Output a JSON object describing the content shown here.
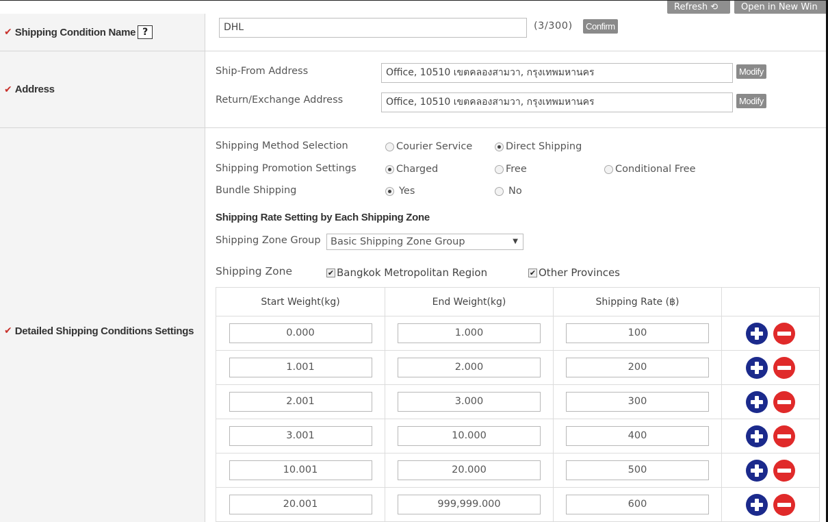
{
  "topbar": {
    "refresh_label": "Refresh ⟲",
    "open_new_label": "Open in New Win"
  },
  "shipping_condition_name": {
    "label": "Shipping Condition Name",
    "help": "?",
    "value": "DHL",
    "counter": "(3/300)",
    "confirm_label": "Confirm"
  },
  "address": {
    "label": "Address",
    "ship_from_label": "Ship-From Address",
    "ship_from_value": "Office, 10510 เขตคลองสามวา, กรุงเทพมหานคร",
    "return_label": "Return/Exchange Address",
    "return_value": "Office, 10510 เขตคลองสามวา, กรุงเทพมหานคร",
    "modify_label": "Modify"
  },
  "detailed": {
    "label": "Detailed Shipping Conditions Settings",
    "method": {
      "label": "Shipping Method Selection",
      "options": [
        "Courier Service",
        "Direct Shipping"
      ],
      "selected": 1
    },
    "promotion": {
      "label": "Shipping Promotion Settings",
      "options": [
        "Charged",
        "Free",
        "Conditional Free"
      ],
      "selected": 0
    },
    "bundle": {
      "label": "Bundle Shipping",
      "options": [
        "Yes",
        "No"
      ],
      "selected": 0
    },
    "rate_section_title": "Shipping Rate Setting by Each Shipping Zone",
    "zone_group": {
      "label": "Shipping Zone Group",
      "value": "Basic Shipping Zone Group"
    },
    "zone": {
      "label": "Shipping Zone",
      "options": [
        "Bangkok Metropolitan Region",
        "Other Provinces"
      ]
    },
    "table": {
      "headers": [
        "Start Weight(kg)",
        "End Weight(kg)",
        "Shipping Rate (฿)"
      ],
      "rows": [
        [
          "0.000",
          "1.000",
          "100"
        ],
        [
          "1.001",
          "2.000",
          "200"
        ],
        [
          "2.001",
          "3.000",
          "300"
        ],
        [
          "3.001",
          "10.000",
          "400"
        ],
        [
          "10.001",
          "20.000",
          "500"
        ],
        [
          "20.001",
          "999,999.000",
          "600"
        ]
      ]
    }
  },
  "colors": {
    "check": "#c8302a",
    "plus": "#1b2a8c",
    "minus": "#e02a2a",
    "button_gray": "#8a8a8a"
  }
}
